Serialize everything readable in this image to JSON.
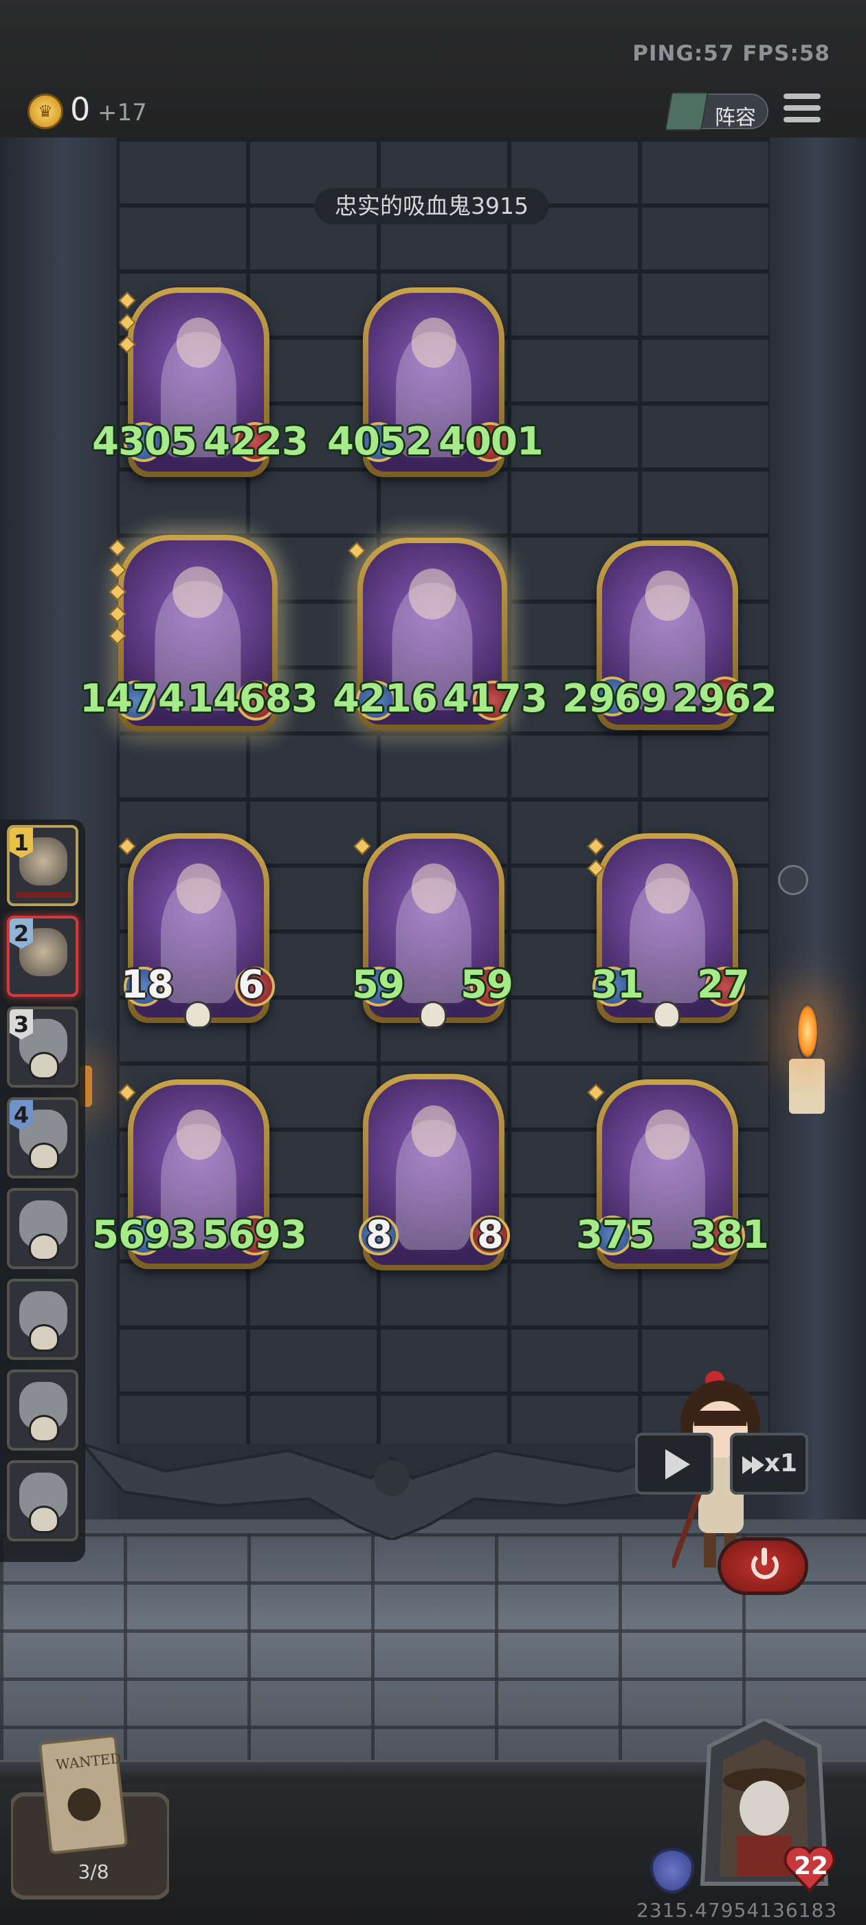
{
  "status": {
    "ping_fps": "PING:57   FPS:58"
  },
  "resources": {
    "gold": "0",
    "income": "+17"
  },
  "header": {
    "lineup_label": "阵容"
  },
  "opponent": {
    "name": "忠实的吸血鬼3915"
  },
  "board": {
    "units": [
      {
        "atk": "4305",
        "hp": "4223",
        "stars": 3
      },
      {
        "atk": "4052",
        "hp": "4001",
        "stars": 0
      },
      {
        "atk": "1474",
        "hp": "14683",
        "stars": 5
      },
      {
        "atk": "4216",
        "hp": "4173",
        "stars": 1
      },
      {
        "atk": "2969",
        "hp": "2962",
        "stars": 0
      },
      {
        "atk": "18",
        "hp": "6",
        "stars": 1
      },
      {
        "atk": "59",
        "hp": "59",
        "stars": 1
      },
      {
        "atk": "31",
        "hp": "27",
        "stars": 2
      },
      {
        "atk": "5693",
        "hp": "5693",
        "stars": 1
      },
      {
        "atk": "8",
        "hp": "8",
        "stars": 0
      },
      {
        "atk": "375",
        "hp": "381",
        "stars": 1
      }
    ]
  },
  "roster": {
    "slots": [
      {
        "rank": "1",
        "badge_color": "#e8c04a"
      },
      {
        "rank": "2",
        "badge_color": "#8fb4d6"
      },
      {
        "rank": "3",
        "badge_color": "#d9d9d9"
      },
      {
        "rank": "4",
        "badge_color": "#6f93c9"
      },
      {
        "rank": ""
      },
      {
        "rank": ""
      },
      {
        "rank": ""
      },
      {
        "rank": ""
      }
    ]
  },
  "controls": {
    "speed_label": "x1"
  },
  "bottom": {
    "wanted_count": "3/8",
    "hero_hp": "22",
    "coords": "2315.47954136183"
  },
  "colors": {
    "stat_green": "#a6ea8a",
    "gold_frame": "#c9a34a",
    "danger_red": "#c0332e"
  }
}
